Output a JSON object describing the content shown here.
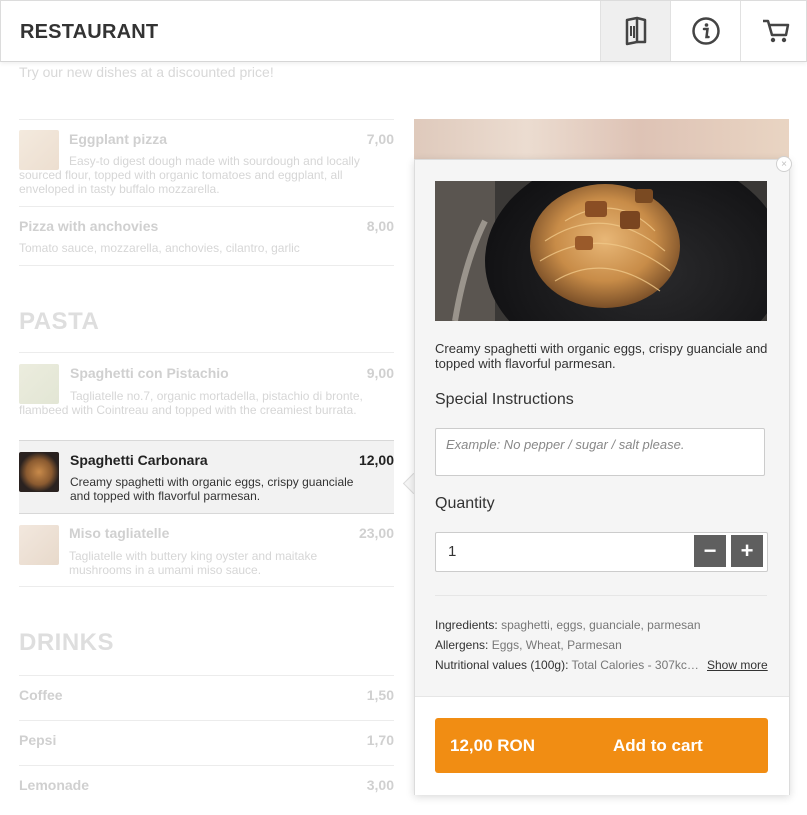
{
  "header": {
    "brand": "RESTAURANT",
    "icons": [
      "menu-book-icon",
      "info-icon",
      "cart-icon"
    ]
  },
  "promo": "Try our new dishes at a discounted price!",
  "menu": {
    "pizza_items": [
      {
        "name": "Eggplant pizza",
        "price": "7,00",
        "desc": "Easy-to digest dough made with sourdough and locally sourced flour, topped with organic tomatoes and eggplant, all enveloped in tasty buffalo mozzarella."
      },
      {
        "name": "Pizza with anchovies",
        "price": "8,00",
        "desc": "Tomato sauce, mozzarella, anchovies, cilantro, garlic"
      }
    ],
    "pasta_title": "PASTA",
    "pasta_items": [
      {
        "name": "Spaghetti con Pistachio",
        "price": "9,00",
        "desc": "Tagliatelle no.7, organic mortadella, pistachio di bronte, flambeed with Cointreau and topped with the creamiest burrata."
      },
      {
        "name": "Spaghetti Carbonara",
        "price": "12,00",
        "desc": "Creamy spaghetti with organic eggs, crispy guanciale and topped with flavorful parmesan."
      },
      {
        "name": "Miso tagliatelle",
        "price": "23,00",
        "desc": "Tagliatelle with buttery king oyster and maitake mushrooms in a umami miso sauce."
      }
    ],
    "drinks_title": "DRINKS",
    "drinks_items": [
      {
        "name": "Coffee",
        "price": "1,50"
      },
      {
        "name": "Pepsi",
        "price": "1,70"
      },
      {
        "name": "Lemonade",
        "price": "3,00"
      }
    ]
  },
  "popup": {
    "close": "×",
    "description": "Creamy spaghetti with organic eggs, crispy guanciale and topped with flavorful parmesan.",
    "instructions_label": "Special Instructions",
    "instructions_placeholder": "Example: No pepper / sugar / salt please.",
    "quantity_label": "Quantity",
    "quantity_value": "1",
    "minus": "−",
    "plus": "+",
    "ingredients_label": "Ingredients:",
    "ingredients_value": "spaghetti, eggs, guanciale, parmesan",
    "allergens_label": "Allergens:",
    "allergens_value": "Eggs, Wheat, Parmesan",
    "nutrition_label": "Nutritional values (100g):",
    "nutrition_value": "Total Calories - 307kc…",
    "show_more": "Show more",
    "price": "12,00 RON",
    "add_to_cart": "Add to cart"
  },
  "colors": {
    "accent": "#f18d13",
    "stepper": "#5f5f5f"
  }
}
